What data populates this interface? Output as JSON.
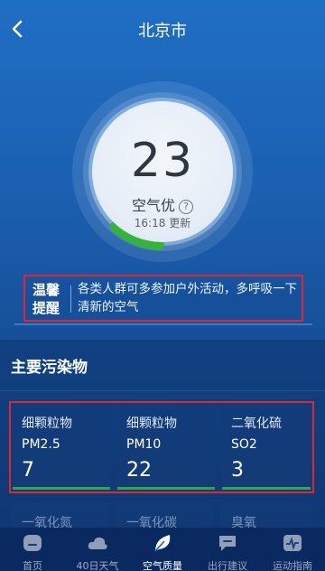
{
  "header": {
    "title": "北京市"
  },
  "aqi": {
    "value": "23",
    "level": "空气优",
    "help": "?",
    "update_time": "16:18 更新"
  },
  "reminder": {
    "label": "温馨提醒",
    "text": "各类人群可多参加户外活动，多呼吸一下清新的空气"
  },
  "pollutants_section": {
    "title": "主要污染物",
    "cards": [
      {
        "name": "细颗粒物",
        "code": "PM2.5",
        "value": "7"
      },
      {
        "name": "细颗粒物",
        "code": "PM10",
        "value": "22"
      },
      {
        "name": "二氧化硫",
        "code": "SO2",
        "value": "3"
      }
    ],
    "row2": [
      "一氧化氮",
      "一氧化碳",
      "臭氧"
    ]
  },
  "bottom_nav": {
    "items": [
      {
        "label": "首页",
        "icon": "home-icon"
      },
      {
        "label": "40日天气",
        "icon": "cloud-icon"
      },
      {
        "label": "空气质量",
        "icon": "leaf-icon"
      },
      {
        "label": "出行建议",
        "icon": "chat-icon"
      },
      {
        "label": "运动指南",
        "icon": "pulse-icon"
      }
    ],
    "active_index": 2
  },
  "colors": {
    "accent_green": "#2faa49",
    "highlight_red": "#e3262d"
  }
}
